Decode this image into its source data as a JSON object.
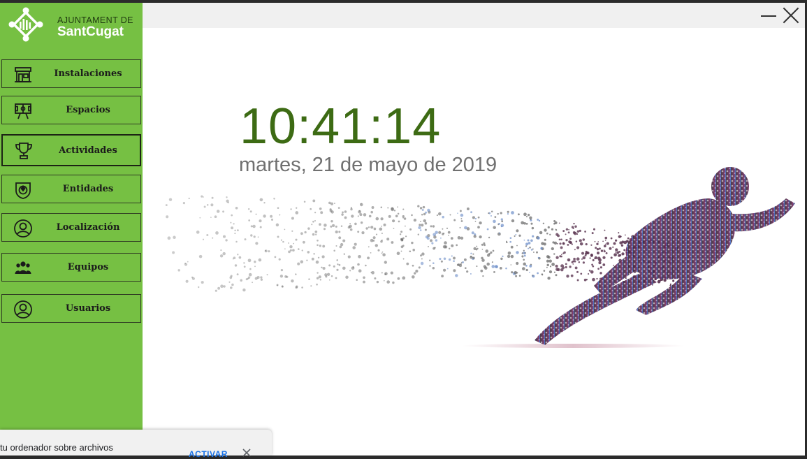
{
  "window": {
    "controls": {
      "minimize_icon": "minimize-icon",
      "close_icon": "close-icon"
    }
  },
  "logo": {
    "line1": "AJUNTAMENT DE",
    "line2": "SantCugat",
    "icon": "sant-cugat-logo-icon"
  },
  "sidebar": {
    "items": [
      {
        "label": "Instalaciones",
        "icon": "building-icon",
        "active": false
      },
      {
        "label": "Espacios",
        "icon": "field-sign-icon",
        "active": false
      },
      {
        "label": "Actividades",
        "icon": "trophy-icon",
        "active": true
      },
      {
        "label": "Entidades",
        "icon": "badge-icon",
        "active": false
      },
      {
        "label": "Localización",
        "icon": "user-circle-icon",
        "active": false
      },
      {
        "label": "Equipos",
        "icon": "team-icon",
        "active": false
      },
      {
        "label": "Usuarios",
        "icon": "user-circle-icon",
        "active": false
      }
    ]
  },
  "main": {
    "time": "10:41:14",
    "date": "martes, 21 de mayo de 2019",
    "background_image": "particle-runner-illustration"
  },
  "toast": {
    "text": "tu ordenador sobre archivos",
    "action": "ACTIVAR",
    "close_icon": "close-icon"
  },
  "colors": {
    "sidebar": "#76c043",
    "clock": "#3d6b14",
    "date": "#707070",
    "toast_action": "#1a73e8"
  }
}
